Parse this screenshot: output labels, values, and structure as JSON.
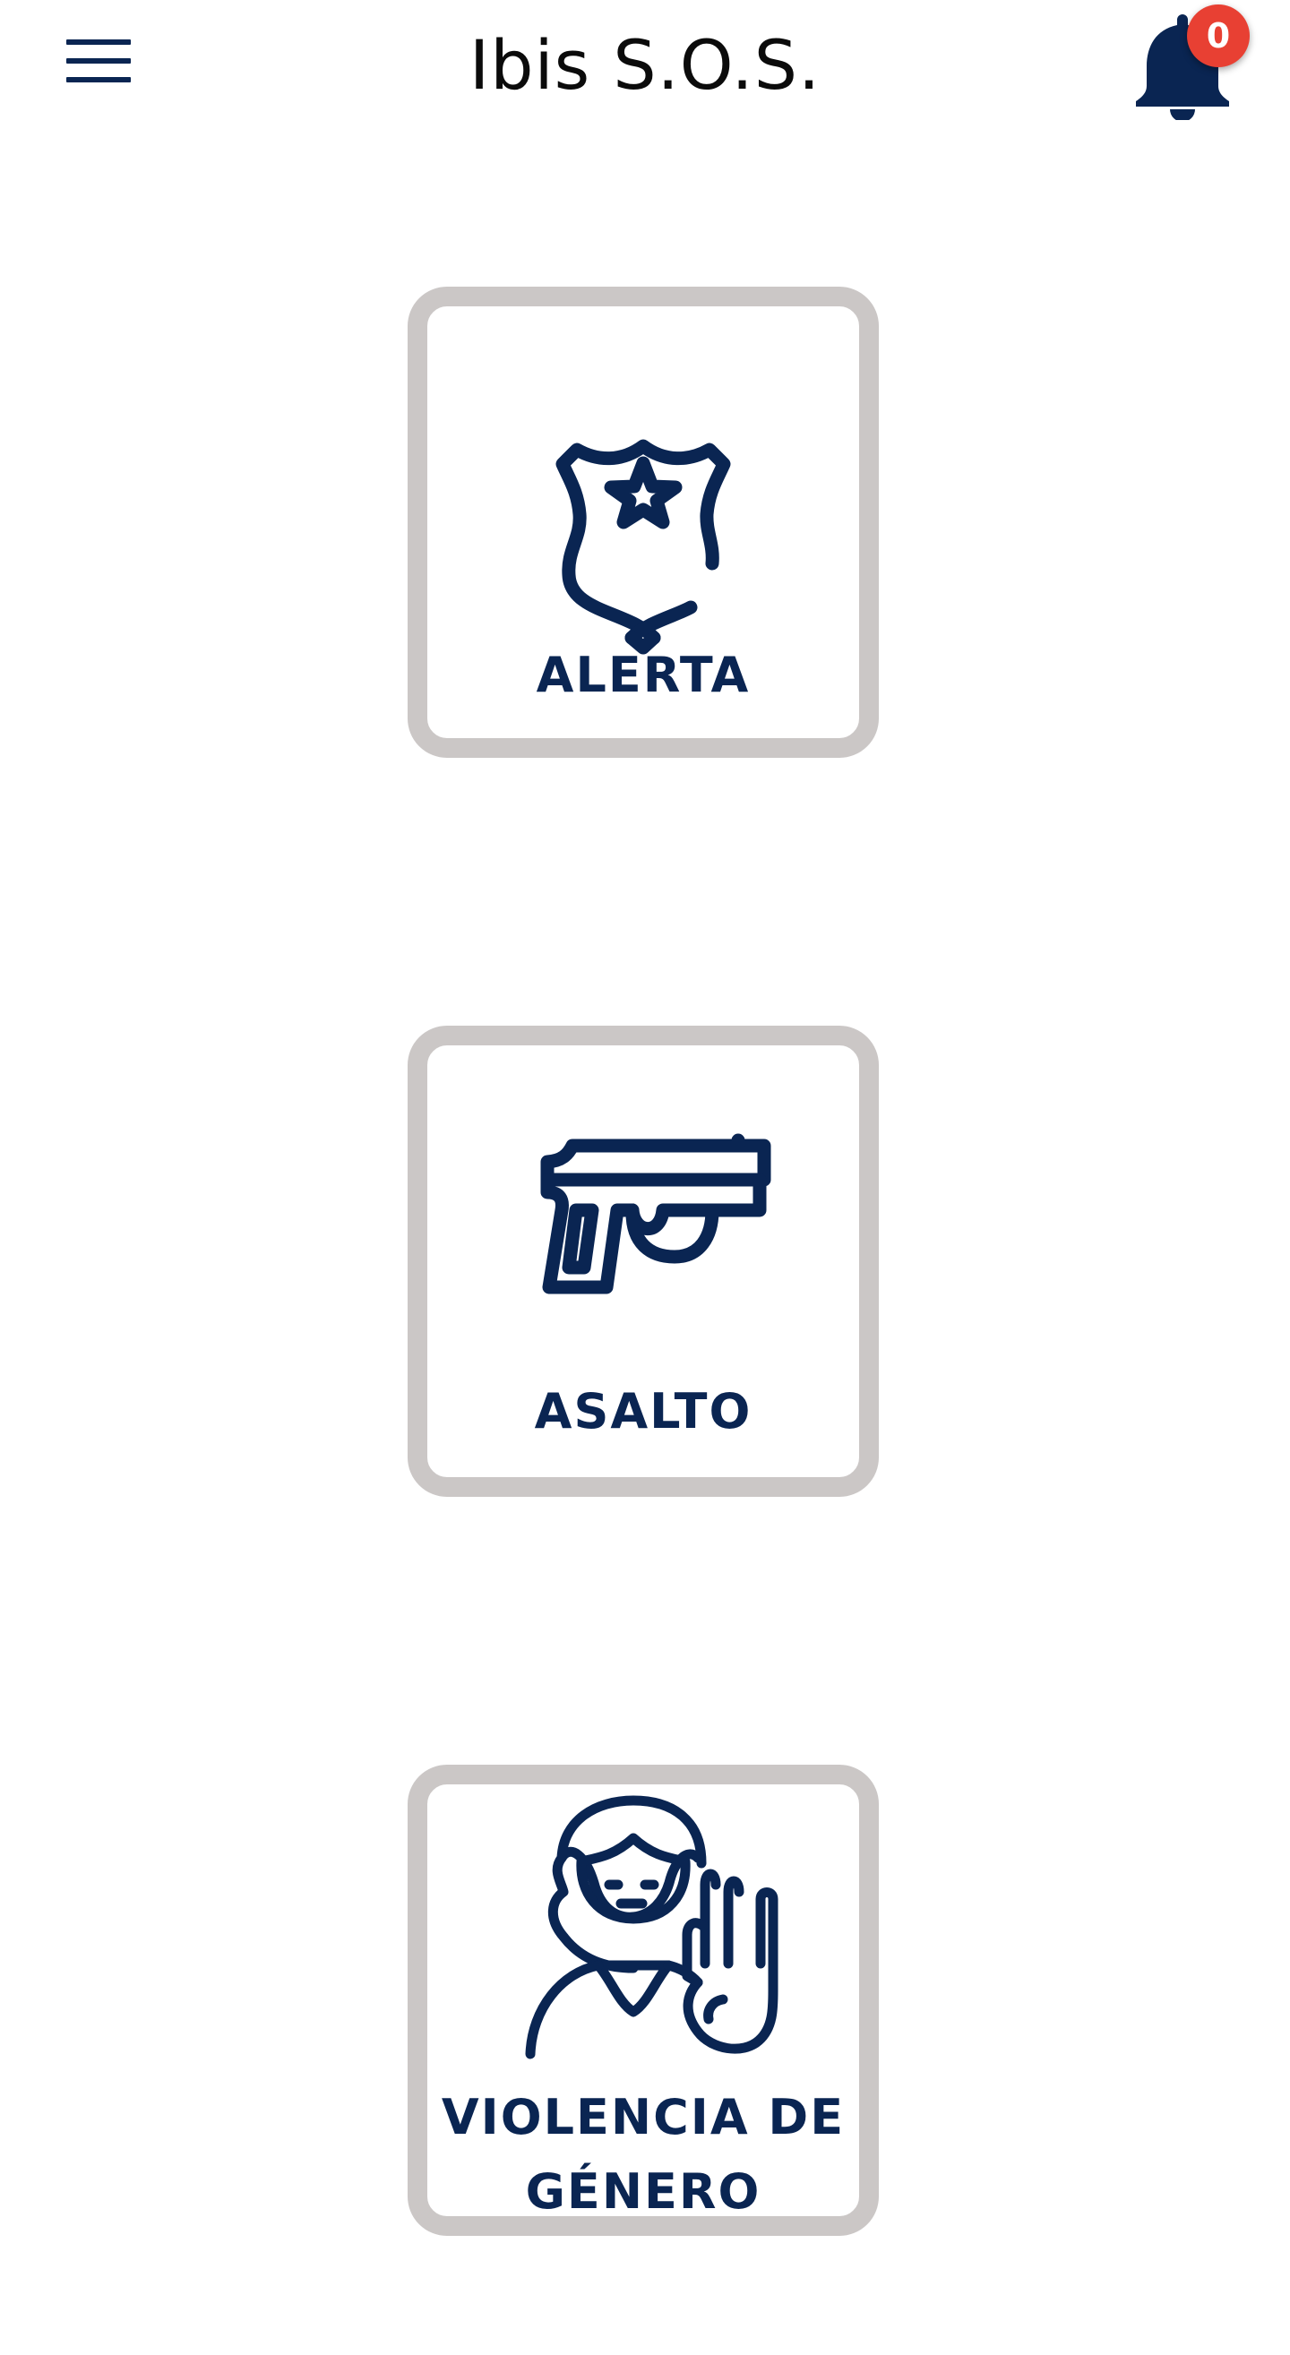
{
  "header": {
    "title": "Ibis S.O.S.",
    "menu_icon": "hamburger-menu-icon",
    "notifications_icon": "bell-icon",
    "notification_count": "0"
  },
  "cards": [
    {
      "label": "ALERTA",
      "icon": "police-badge-icon"
    },
    {
      "label": "ASALTO",
      "icon": "pistol-icon"
    },
    {
      "label_line1": "VIOLENCIA DE",
      "label_line2": "GÉNERO",
      "icon": "woman-stop-hand-icon"
    }
  ],
  "colors": {
    "primary": "#0a2552",
    "card_border": "#cbc7c6",
    "badge": "#e84033",
    "title": "#0b0b0b",
    "background": "#ffffff"
  }
}
